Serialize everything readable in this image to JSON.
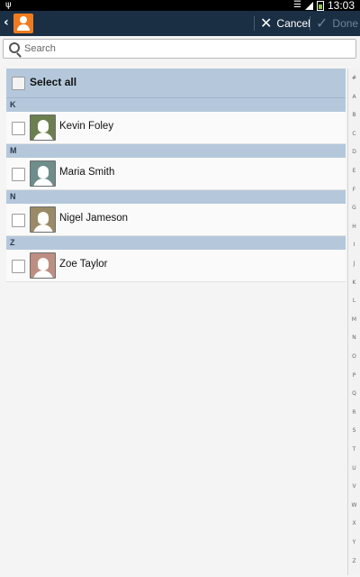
{
  "status_bar": {
    "time": "13:03"
  },
  "action_bar": {
    "cancel_label": "Cancel",
    "done_label": "Done"
  },
  "search": {
    "placeholder": "Search"
  },
  "select_all_label": "Select all",
  "sections": [
    {
      "letter": "K",
      "contact": {
        "name": "Kevin Foley",
        "avatar_color": "#6b7f4f"
      }
    },
    {
      "letter": "M",
      "contact": {
        "name": "Maria Smith",
        "avatar_color": "#6f8d8b"
      }
    },
    {
      "letter": "N",
      "contact": {
        "name": "Nigel Jameson",
        "avatar_color": "#9b8a66"
      }
    },
    {
      "letter": "Z",
      "contact": {
        "name": "Zoe Taylor",
        "avatar_color": "#bd8e82"
      }
    }
  ],
  "index_letters": [
    "#",
    "A",
    "B",
    "C",
    "D",
    "E",
    "F",
    "G",
    "H",
    "I",
    "J",
    "K",
    "L",
    "M",
    "N",
    "O",
    "P",
    "Q",
    "R",
    "S",
    "T",
    "U",
    "V",
    "W",
    "X",
    "Y",
    "Z"
  ]
}
